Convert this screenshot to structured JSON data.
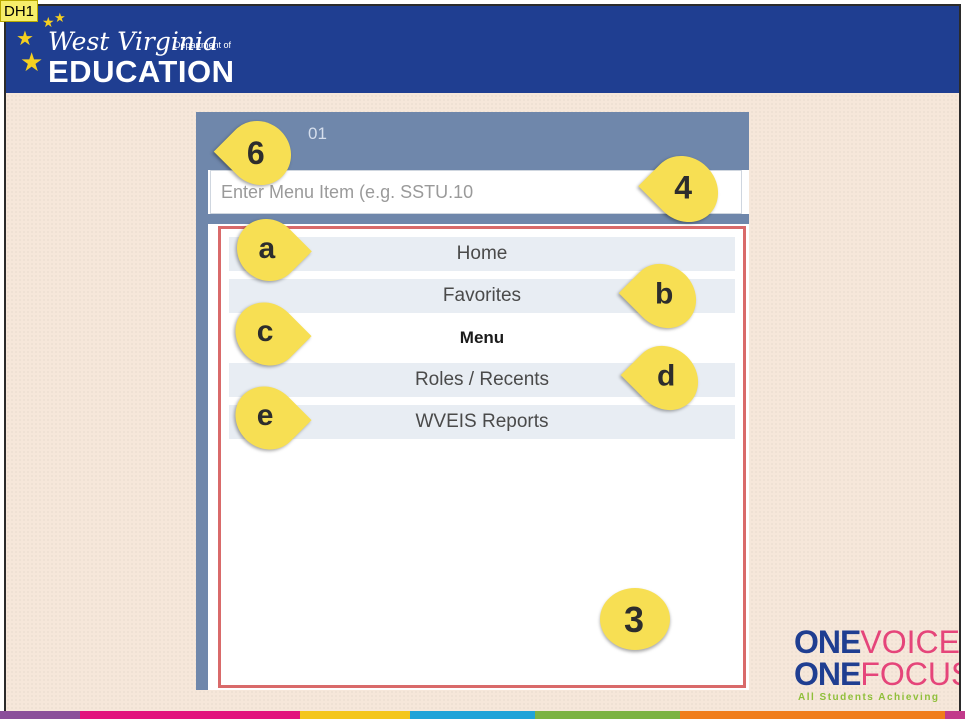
{
  "comment_tag": "DH1",
  "header": {
    "logo_script": "West Virginia",
    "logo_sub": "Department of",
    "logo_main": "EDUCATION",
    "colors": {
      "band": "#1f3e91",
      "star": "#f5d020"
    }
  },
  "screenshot": {
    "title_fragment": "01",
    "search_placeholder": "Enter Menu Item (e.g. SSTU.10",
    "menu_items": [
      {
        "label": "Home",
        "active": false
      },
      {
        "label": "Favorites",
        "active": false
      },
      {
        "label": "Menu",
        "active": true
      },
      {
        "label": "Roles / Recents",
        "active": false
      },
      {
        "label": "WVEIS Reports",
        "active": false
      }
    ]
  },
  "callouts": {
    "six": "6",
    "four": "4",
    "a": "a",
    "b": "b",
    "c": "c",
    "d": "d",
    "e": "e",
    "three": "3"
  },
  "brand": {
    "line1_prefix": "ONE",
    "line1_word": "VOICE",
    "line2_prefix": "ONE",
    "line2_word": "FOCUS",
    "tagline": "All Students Achieving"
  },
  "footer_colors": [
    "#8b4f9a",
    "#e2137d",
    "#f4c61c",
    "#1ea3d8",
    "#7cb342",
    "#f07d1b",
    "#c23a8b"
  ]
}
